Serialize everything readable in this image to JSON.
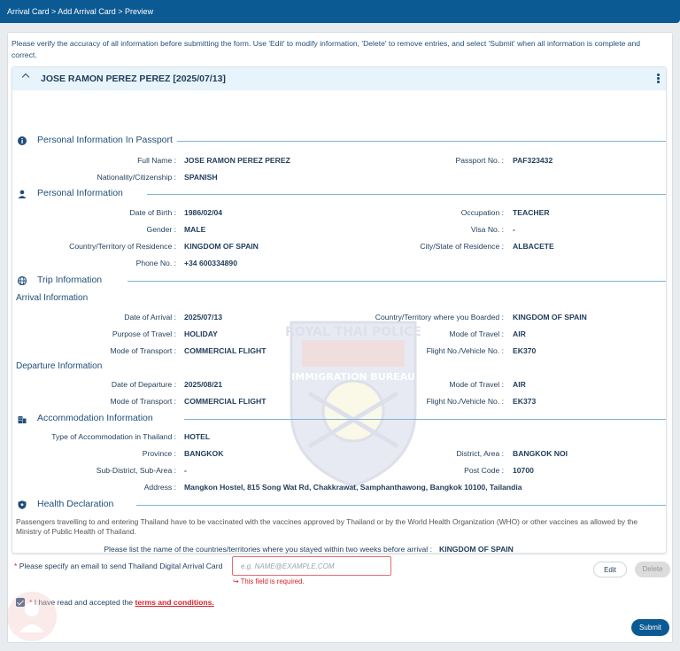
{
  "breadcrumb": "Arrival Card > Add Arrival Card > Preview",
  "notice": "Please verify the accuracy of all information before submitting the form. Use 'Edit' to modify information, 'Delete' to remove entries, and select 'Submit' when all information is complete and correct.",
  "panel_title": "JOSE RAMON PEREZ PEREZ [2025/07/13]",
  "watermark_text": {
    "top": "ROYAL THAI POLICE",
    "middle": "IMMIGRATION BUREAU"
  },
  "sections": {
    "passport": "Personal Information In Passport",
    "personal": "Personal Information",
    "trip": "Trip Information",
    "arrival": "Arrival Information",
    "departure": "Departure Information",
    "accommodation": "Accommodation Information",
    "health": "Health Declaration"
  },
  "passport": {
    "full_name_label": "Full Name :",
    "full_name": "JOSE RAMON PEREZ PEREZ",
    "passport_label": "Passport No. :",
    "passport_no": "PAF323432",
    "nationality_label": "Nationality/Citizenship :",
    "nationality": "SPANISH"
  },
  "personal": {
    "dob_label": "Date of Birth :",
    "dob": "1986/02/04",
    "occupation_label": "Occupation :",
    "occupation": "TEACHER",
    "gender_label": "Gender :",
    "gender": "MALE",
    "visa_label": "Visa No. :",
    "visa": "-",
    "residence_label": "Country/Territory of Residence :",
    "residence": "KINGDOM OF SPAIN",
    "city_label": "City/State of Residence :",
    "city": "ALBACETE",
    "phone_label": "Phone No. :",
    "phone": "+34 600334890"
  },
  "arrival": {
    "date_label": "Date of Arrival :",
    "date": "2025/07/13",
    "boarded_label": "Country/Territory where you Boarded :",
    "boarded": "KINGDOM OF SPAIN",
    "purpose_label": "Purpose of Travel :",
    "purpose": "HOLIDAY",
    "mode_label": "Mode of Travel :",
    "mode": "AIR",
    "transport_label": "Mode of Transport :",
    "transport": "COMMERCIAL FLIGHT",
    "flight_label": "Flight No./Vehicle No. :",
    "flight": "EK370"
  },
  "departure": {
    "date_label": "Date of Departure :",
    "date": "2025/08/21",
    "mode_label": "Mode of Travel :",
    "mode": "AIR",
    "transport_label": "Mode of Transport :",
    "transport": "COMMERCIAL FLIGHT",
    "flight_label": "Flight No./Vehicle No. :",
    "flight": "EK373"
  },
  "accommodation": {
    "type_label": "Type of Accommodation in Thailand :",
    "type": "HOTEL",
    "province_label": "Province :",
    "province": "BANGKOK",
    "district_label": "District, Area :",
    "district": "BANGKOK NOI",
    "subdistrict_label": "Sub-District, Sub-Area :",
    "subdistrict": "-",
    "postcode_label": "Post Code :",
    "postcode": "10700",
    "address_label": "Address :",
    "address": "Mangkon Hostel, 815 Song Wat Rd, Chakkrawat, Samphanthawong, Bangkok 10100, Tailandia"
  },
  "health": {
    "text": "Passengers travelling to and entering Thailand have to be vaccinated with the vaccines approved by Thailand or by the World Health Organization (WHO) or other vaccines as allowed by the Ministry of Public Health of Thailand.",
    "countries_label": "Please list the name of the countries/territories where you stayed within two weeks before arrival :",
    "countries": "KINGDOM OF SPAIN"
  },
  "buttons": {
    "edit": "Edit",
    "delete": "Delete",
    "submit": "Submit"
  },
  "email": {
    "required_mark": "*",
    "label": "Please specify an email to send Thailand Digital Arrival Card",
    "placeholder": "e.g. NAME@EXAMPLE.COM",
    "error": "This field is required."
  },
  "terms": {
    "required_mark": "*",
    "prefix": "I have read and accepted the",
    "link": "terms and conditions."
  },
  "colors": {
    "primary": "#0c5a93",
    "header_bg": "#e8f4fb",
    "error": "#d9212c",
    "text": "#1f3c5a"
  }
}
